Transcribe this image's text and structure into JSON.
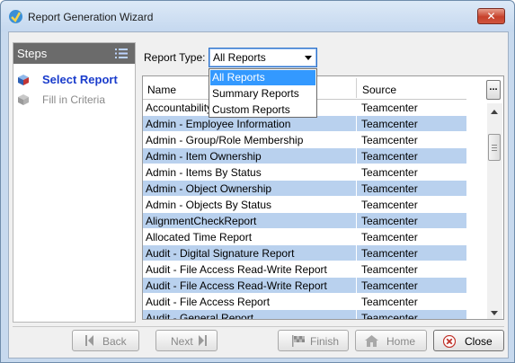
{
  "window": {
    "title": "Report Generation Wizard",
    "close_glyph": "✕"
  },
  "steps": {
    "title": "Steps",
    "items": [
      {
        "label": "Select Report",
        "icon": "cube-icon",
        "state": "active"
      },
      {
        "label": "Fill in Criteria",
        "icon": "cube-gray-icon",
        "state": "inactive"
      }
    ]
  },
  "report_type": {
    "label": "Report Type:",
    "value": "All Reports",
    "options": [
      "All Reports",
      "Summary Reports",
      "Custom Reports"
    ]
  },
  "grid": {
    "columns": [
      "Name",
      "Source"
    ],
    "more_label": "...",
    "rows": [
      {
        "name": "Accountability Check",
        "source": "Teamcenter"
      },
      {
        "name": "Admin - Employee Information",
        "source": "Teamcenter"
      },
      {
        "name": "Admin - Group/Role Membership",
        "source": "Teamcenter"
      },
      {
        "name": "Admin - Item Ownership",
        "source": "Teamcenter"
      },
      {
        "name": "Admin - Items By Status",
        "source": "Teamcenter"
      },
      {
        "name": "Admin - Object Ownership",
        "source": "Teamcenter"
      },
      {
        "name": "Admin - Objects By Status",
        "source": "Teamcenter"
      },
      {
        "name": "AlignmentCheckReport",
        "source": "Teamcenter"
      },
      {
        "name": "Allocated Time Report",
        "source": "Teamcenter"
      },
      {
        "name": "Audit - Digital Signature Report",
        "source": "Teamcenter"
      },
      {
        "name": "Audit - File Access Read-Write Report",
        "source": "Teamcenter"
      },
      {
        "name": "Audit - File Access Read-Write Report",
        "source": "Teamcenter"
      },
      {
        "name": "Audit - File Access Report",
        "source": "Teamcenter"
      },
      {
        "name": "Audit - General Report",
        "source": "Teamcenter"
      }
    ]
  },
  "buttons": {
    "back": "Back",
    "next": "Next",
    "finish": "Finish",
    "home": "Home",
    "close": "Close"
  },
  "colors": {
    "selected_row": "#b9d1ee",
    "highlight": "#3399ff",
    "active_step": "#1a3ccc"
  }
}
